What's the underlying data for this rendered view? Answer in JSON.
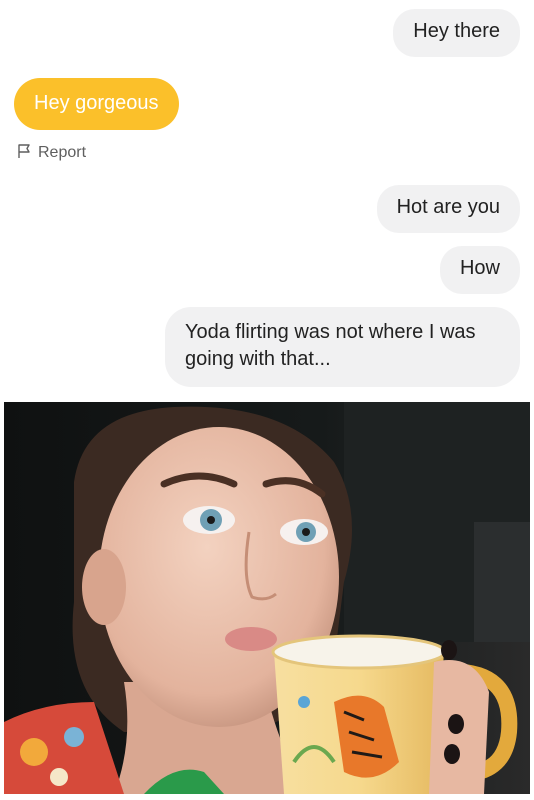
{
  "messages": [
    {
      "direction": "outgoing",
      "text": "Hey there"
    },
    {
      "direction": "incoming",
      "text": "Hey gorgeous"
    },
    {
      "direction": "outgoing",
      "text": "Hot are you"
    },
    {
      "direction": "outgoing",
      "text": "How"
    },
    {
      "direction": "outgoing",
      "text": "Yoda flirting was not where I was going with that..."
    }
  ],
  "report": {
    "label": "Report",
    "icon": "flag-icon"
  },
  "colors": {
    "incoming_bubble": "#fbc02a",
    "outgoing_bubble": "#f1f1f2",
    "incoming_text": "#ffffff",
    "outgoing_text": "#222222"
  },
  "photo": {
    "subject": "selfie-with-mug"
  }
}
